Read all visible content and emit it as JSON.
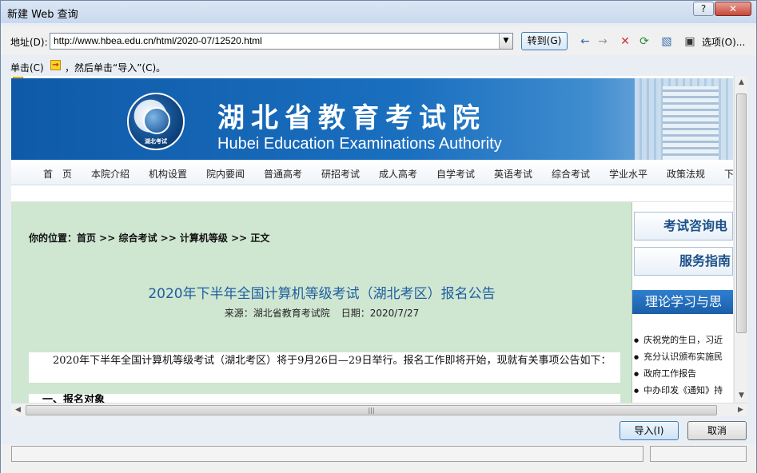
{
  "window": {
    "title": "新建 Web 查询",
    "help": "?",
    "close": "✕"
  },
  "address_bar": {
    "label": "地址(D):",
    "url": "http://www.hbea.edu.cn/html/2020-07/12520.html",
    "go_label": "转到(G)",
    "options_label": "选项(O)..."
  },
  "hint": {
    "prefix": "单击(C)",
    "suffix": "，然后单击“导入”(C)。"
  },
  "site": {
    "name_cn": "湖北省教育考试院",
    "name_en": "Hubei Education Examinations Authority",
    "logo_text": "湖北考试",
    "nav": [
      "首　页",
      "本院介绍",
      "机构设置",
      "院内要闻",
      "普通高考",
      "研招考试",
      "成人高考",
      "自学考试",
      "英语考试",
      "综合考试",
      "学业水平",
      "政策法规",
      "下"
    ]
  },
  "article": {
    "breadcrumb": "你的位置：首页 >> 综合考试 >> 计算机等级 >> 正文",
    "title": "2020年下半年全国计算机等级考试（湖北考区）报名公告",
    "source": "来源：湖北省教育考试院",
    "date": "日期：2020/7/27",
    "paragraph": "　　2020年下半年全国计算机等级考试（湖北考区）将于9月26日—29日举行。报名工作即将开始，现就有关事项公告如下：",
    "section_heading": "　一、报名对象"
  },
  "sidebar": {
    "box1": "考试咨询电",
    "box2": "服务指南",
    "header": "理论学习与思",
    "items": [
      "庆祝党的生日，习近",
      "充分认识颁布实施民",
      "政府工作报告",
      "中办印发《通知》持"
    ]
  },
  "buttons": {
    "import": "导入(I)",
    "cancel": "取消"
  },
  "scrollbar": {
    "grip": "|||"
  }
}
